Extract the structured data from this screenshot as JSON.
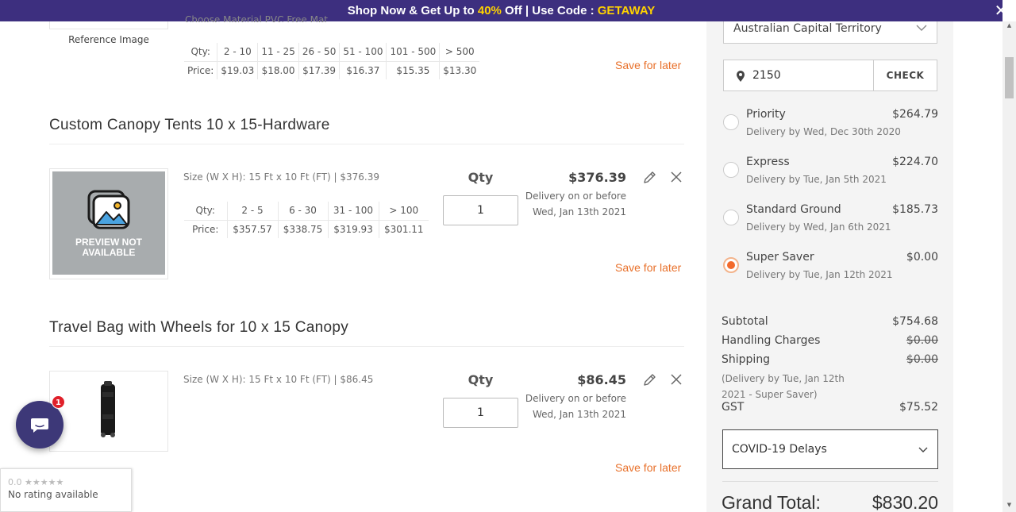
{
  "promo": {
    "prefix": "Shop Now & Get Up to ",
    "discount": "40%",
    "middle": " Off | Use Code : ",
    "code": "GETAWAY",
    "close_icon": "close-icon"
  },
  "items": [
    {
      "image_caption": "Reference Image",
      "cut_text": "Choose Material PVC Free Mat",
      "tiers": {
        "qty_label": "Qty:",
        "price_label": "Price:",
        "qty": [
          "2 - 10",
          "11 - 25",
          "26 - 50",
          "51 - 100",
          "101 - 500",
          "> 500"
        ],
        "price": [
          "$19.03",
          "$18.00",
          "$17.39",
          "$16.37",
          "$15.35",
          "$13.30"
        ]
      },
      "save_for_later": "Save for later"
    },
    {
      "title": "Custom Canopy Tents 10 x 15-Hardware",
      "image_placeholder": "PREVIEW NOT AVAILABLE",
      "size": "Size (W X H): 15 Ft x 10 Ft (FT) | $376.39",
      "tiers": {
        "qty_label": "Qty:",
        "price_label": "Price:",
        "qty": [
          "2 - 5",
          "6 - 30",
          "31 - 100",
          "> 100"
        ],
        "price": [
          "$357.57",
          "$338.75",
          "$319.93",
          "$301.11"
        ]
      },
      "qty_label": "Qty",
      "qty_value": "1",
      "price": "$376.39",
      "delivery_line1": "Delivery on or before",
      "delivery_line2": "Wed, Jan 13th 2021",
      "save_for_later": "Save for later"
    },
    {
      "title": "Travel Bag with Wheels for 10 x 15 Canopy",
      "size": "Size (W X H): 15 Ft x 10 Ft (FT) | $86.45",
      "qty_label": "Qty",
      "qty_value": "1",
      "price": "$86.45",
      "delivery_line1": "Delivery on or before",
      "delivery_line2": "Wed, Jan 13th 2021",
      "save_for_later": "Save for later"
    }
  ],
  "sidebar": {
    "state_select": "Australian Capital Territory",
    "zip_value": "2150",
    "check_label": "CHECK",
    "shipping_options": [
      {
        "name": "Priority",
        "price": "$264.79",
        "delivery": "Delivery by Wed, Dec 30th 2020",
        "selected": false
      },
      {
        "name": "Express",
        "price": "$224.70",
        "delivery": "Delivery by Tue, Jan 5th 2021",
        "selected": false
      },
      {
        "name": "Standard Ground",
        "price": "$185.73",
        "delivery": "Delivery by Wed, Jan 6th 2021",
        "selected": false
      },
      {
        "name": "Super Saver",
        "price": "$0.00",
        "delivery": "Delivery by Tue, Jan 12th 2021",
        "selected": true
      }
    ],
    "summary": {
      "subtotal_label": "Subtotal",
      "subtotal": "$754.68",
      "handling_label": "Handling Charges",
      "handling": "$0.00",
      "shipping_label": "Shipping",
      "shipping": "$0.00",
      "shipping_note": "(Delivery by Tue, Jan 12th 2021 - Super Saver)",
      "gst_label": "GST",
      "gst": "$75.52"
    },
    "covid_label": "COVID-19 Delays",
    "grand_total_label": "Grand Total:",
    "grand_total": "$830.20"
  },
  "chat": {
    "badge": "1"
  },
  "rating": {
    "score": "0.0",
    "stars": "★★★★★",
    "text": "No rating available"
  },
  "colors": {
    "accent": "#e8702a",
    "promo_bg": "#3d2f7f",
    "promo_highlight": "#ffd200",
    "radio_selected": "#f26a2c"
  }
}
